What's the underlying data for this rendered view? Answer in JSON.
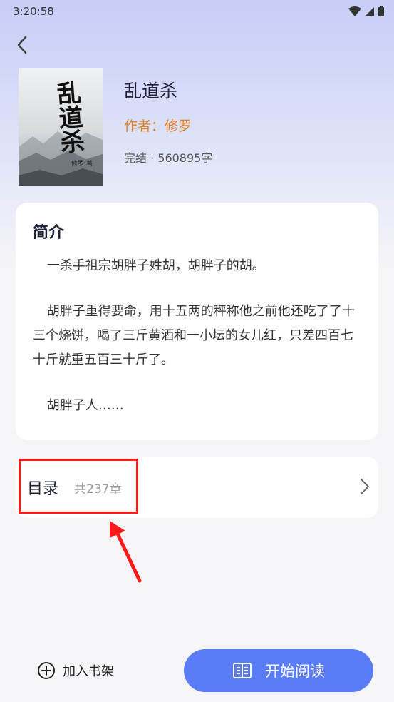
{
  "status_bar": {
    "time": "3:20:58"
  },
  "book": {
    "cover_title": "乱道杀",
    "cover_author": "修罗 著",
    "title": "乱道杀",
    "author": "作者：修罗",
    "meta": "完结 · 560895字"
  },
  "intro": {
    "heading": "简介",
    "paragraphs": [
      "一杀手祖宗胡胖子姓胡，胡胖子的胡。",
      "胡胖子重得要命，用十五两的秤称他之前他还吃了了十三个烧饼，喝了三斤黄酒和一小坛的女儿红，只差四百七十斤就重五百三十斤了。",
      "胡胖子人……"
    ]
  },
  "toc": {
    "label": "目录",
    "count": "共237章"
  },
  "bottom": {
    "shelf_label": "加入书架",
    "read_label": "开始阅读"
  },
  "colors": {
    "accent": "#5b7cf7",
    "author": "#e0812c",
    "highlight": "#ff1a1a"
  },
  "icons": {
    "back": "chevron-left-icon",
    "toc": "chevron-right-icon",
    "shelf": "plus-circle-icon",
    "read": "book-open-icon"
  }
}
